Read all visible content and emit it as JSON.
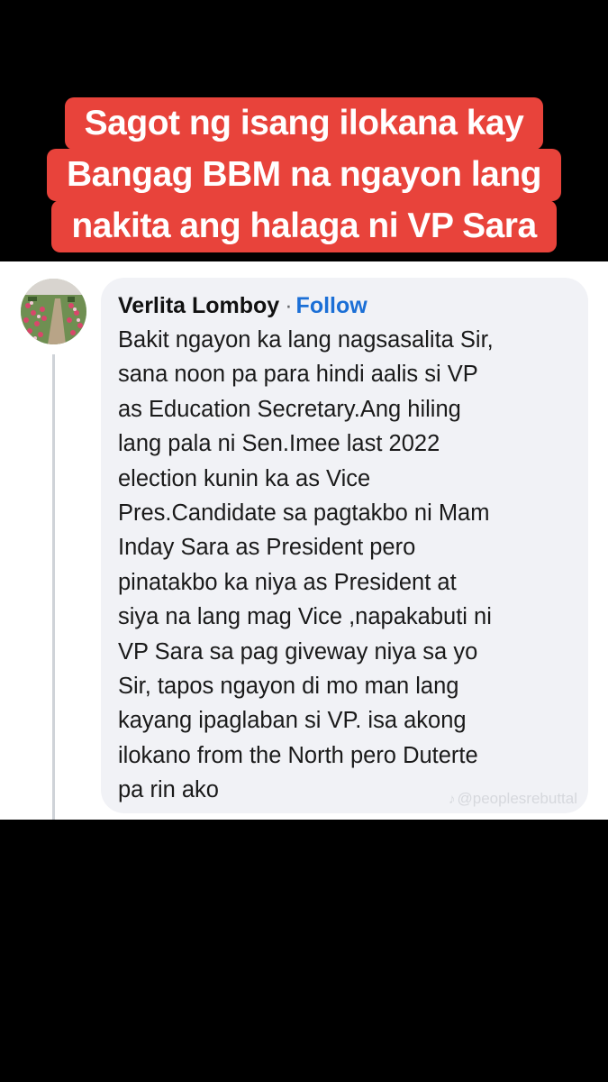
{
  "title": {
    "lines": [
      "Sagot ng isang ilokana kay",
      "Bangag BBM na ngayon lang",
      "nakita ang halaga ni VP Sara"
    ]
  },
  "colors": {
    "background": "#000000",
    "banner": "#e8433b",
    "bubble": "#f1f2f6",
    "follow": "#1b6fd6"
  },
  "comment": {
    "author": "Verlita Lomboy",
    "separator": "·",
    "follow_label": "Follow",
    "avatar_icon": "flower-garden-avatar",
    "lines": [
      "Bakit ngayon ka lang nagsasalita Sir,",
      "sana noon pa para hindi aalis si VP",
      "as Education Secretary.Ang hiling",
      "lang pala ni Sen.Imee last 2022",
      "election kunin ka as Vice",
      "Pres.Candidate sa pagtakbo ni Mam",
      "Inday Sara as President pero",
      "pinatakbo ka niya as President at",
      "siya na lang mag Vice ,napakabuti ni",
      "VP Sara sa pag giveway niya sa yo",
      "Sir, tapos ngayon di mo man lang",
      "kayang ipaglaban si VP. isa akong",
      "ilokano from the North pero Duterte",
      "pa rin ako"
    ]
  },
  "watermark": {
    "icon": "tiktok-icon",
    "text": "@peoplesrebuttal"
  }
}
